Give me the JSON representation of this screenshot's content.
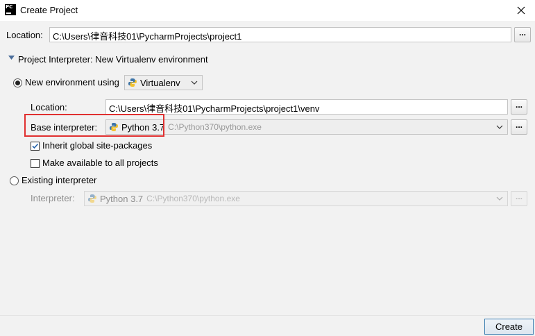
{
  "window": {
    "app_icon": "pycharm-logo-icon",
    "title": "Create Project",
    "close_icon": "close-icon"
  },
  "location": {
    "label": "Location:",
    "value": "C:\\Users\\律音科技01\\PycharmProjects\\project1",
    "browse": "..."
  },
  "interpreter_section": {
    "toggle_icon": "triangle-down-icon",
    "title": "Project Interpreter: New Virtualenv environment"
  },
  "new_env": {
    "radio_label": "New environment using",
    "selected": true,
    "env_type": "Virtualenv",
    "env_type_icon": "python-icon",
    "location_label": "Location:",
    "location_value": "C:\\Users\\律音科技01\\PycharmProjects\\project1\\venv",
    "location_browse": "...",
    "base_label": "Base interpreter:",
    "base_version": "Python 3.7",
    "base_path": "C:\\Python370\\python.exe",
    "base_browse": "...",
    "inherit_label": "Inherit global site-packages",
    "inherit_checked": true,
    "make_available_label": "Make available to all projects",
    "make_available_checked": false
  },
  "existing": {
    "radio_label": "Existing interpreter",
    "selected": false,
    "interpreter_label": "Interpreter:",
    "interpreter_version": "Python 3.7",
    "interpreter_path": "C:\\Python370\\python.exe",
    "browse": "..."
  },
  "footer": {
    "create_label": "Create"
  },
  "colors": {
    "highlight": "#e03030",
    "accent_border": "#3c7fb1",
    "background": "#f2f2f2"
  }
}
